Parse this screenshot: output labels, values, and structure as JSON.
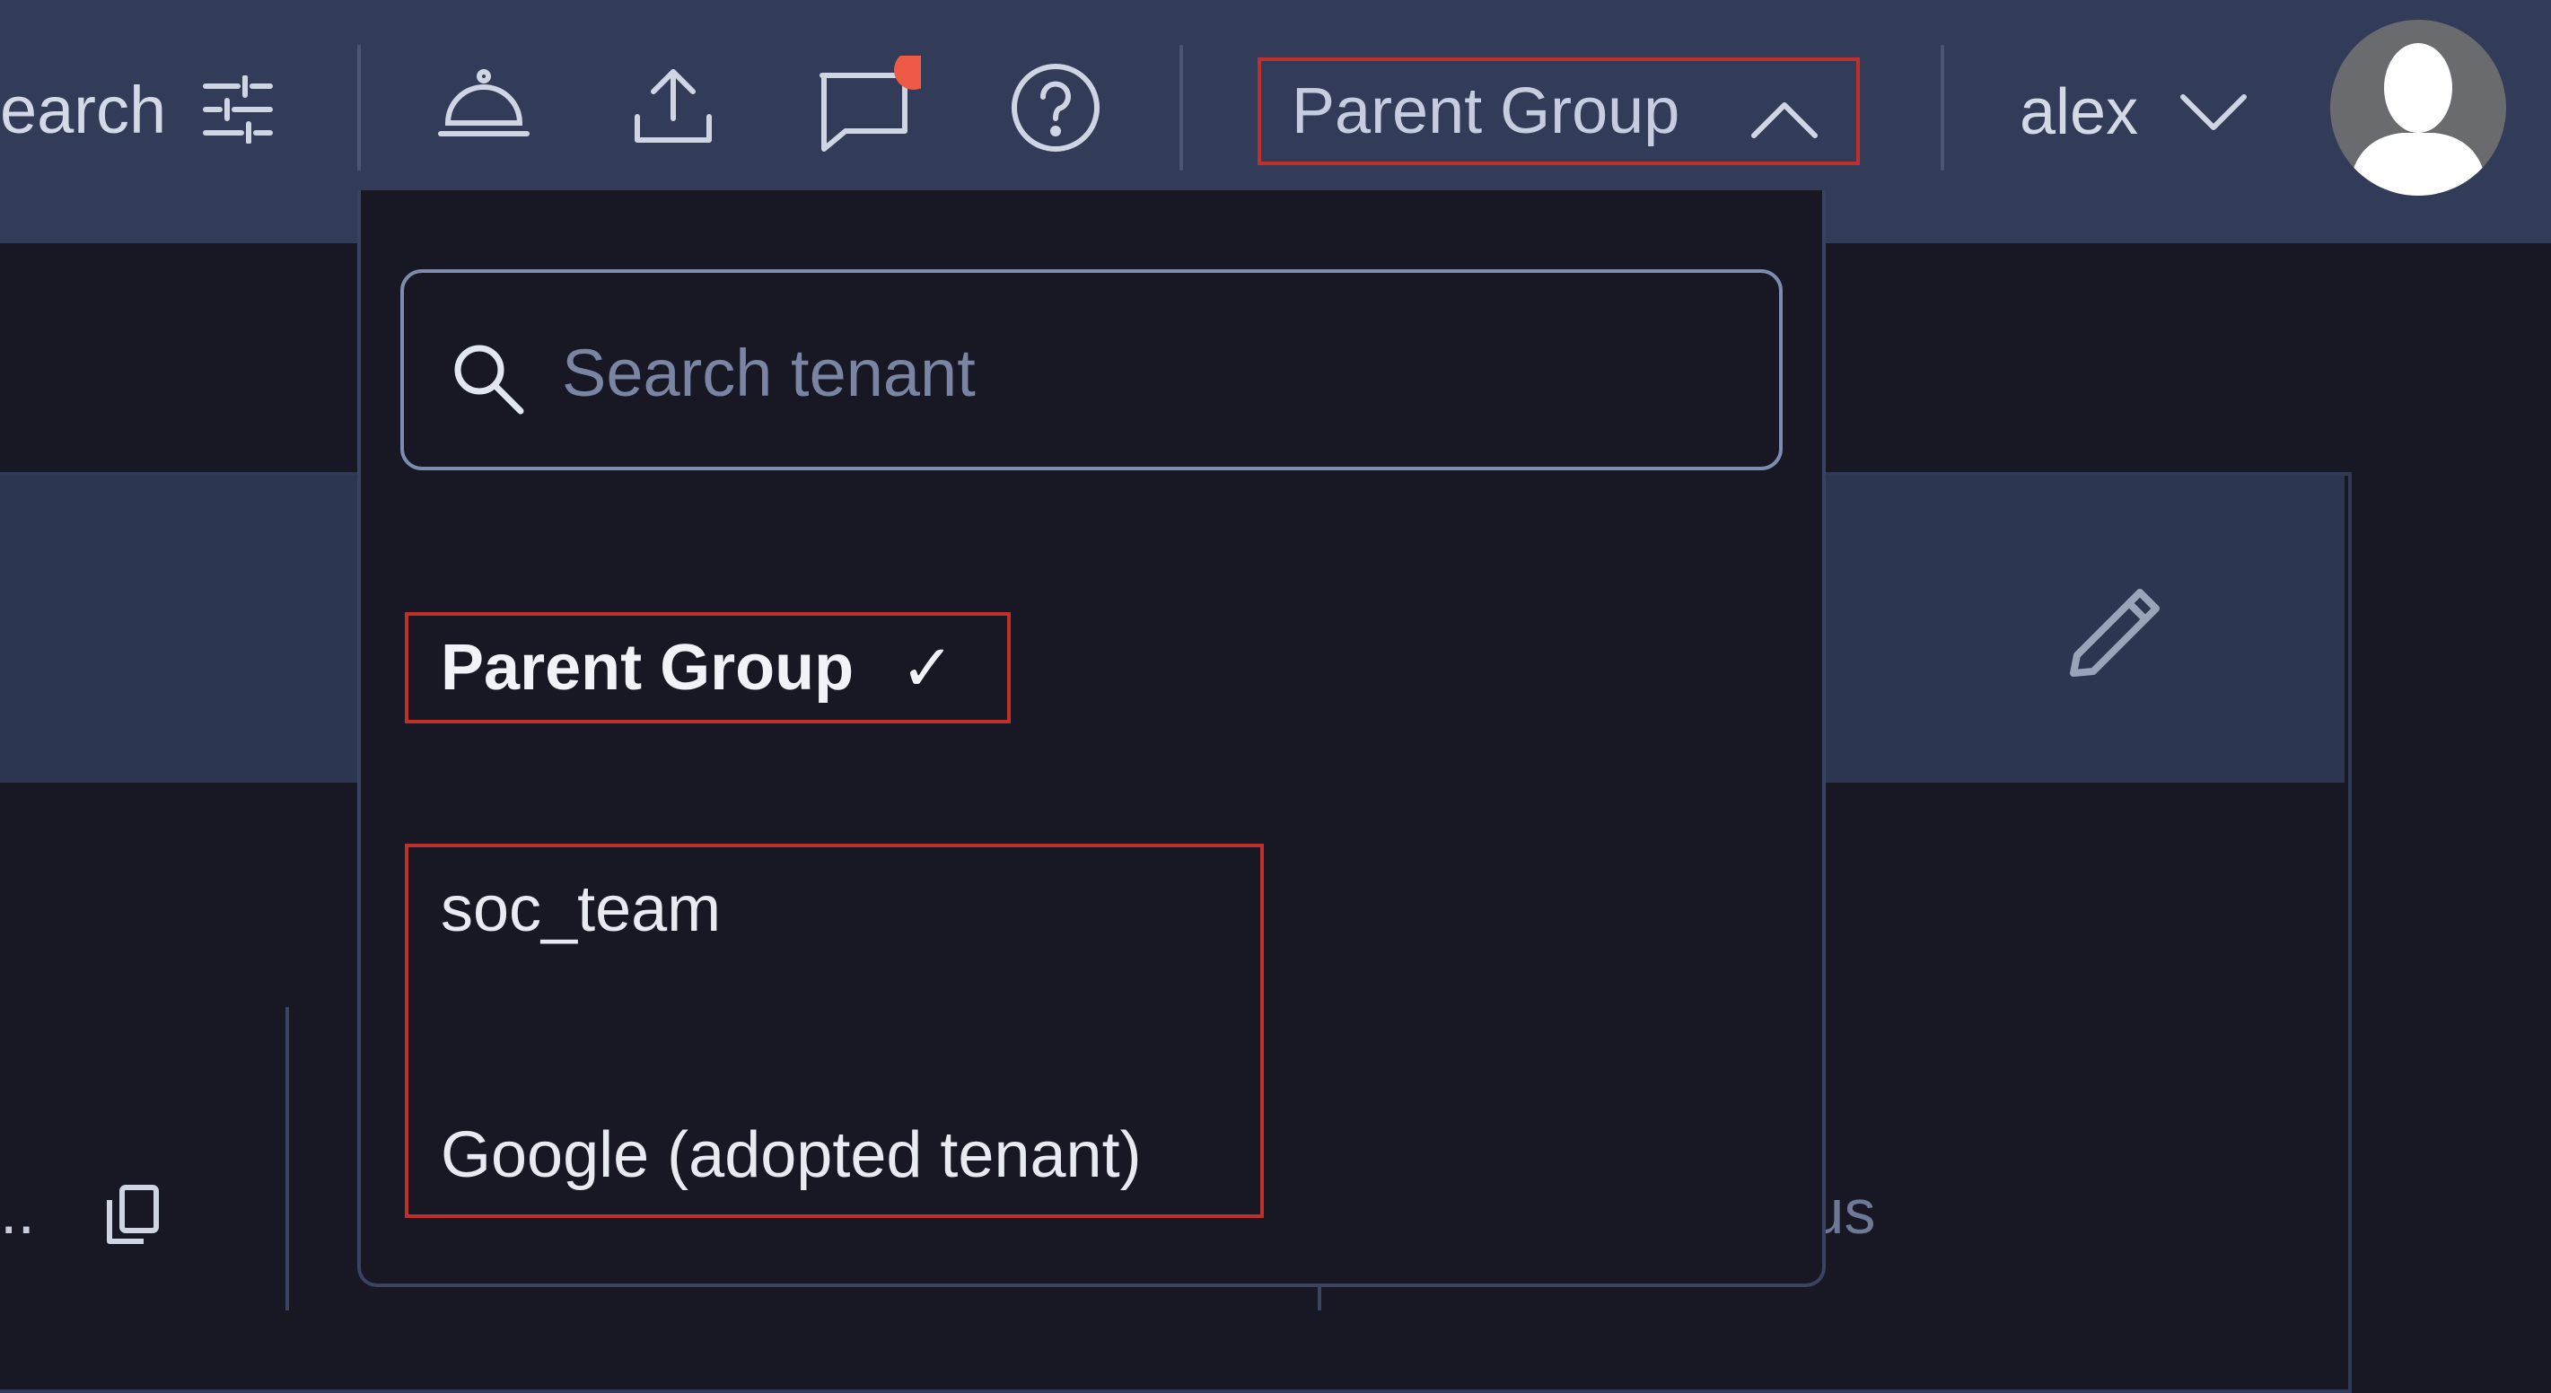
{
  "header": {
    "search_partial": "earch",
    "tenant_selector": {
      "label": "Parent Group"
    },
    "user": {
      "name": "alex"
    }
  },
  "dropdown": {
    "search_placeholder": "Search tenant",
    "selected_option": {
      "label": "Parent Group",
      "check": "✓"
    },
    "options": [
      {
        "label": "soc_team"
      },
      {
        "label": "Google (adopted tenant)"
      }
    ]
  },
  "background": {
    "truncated_text": "..",
    "partial_text": "lus"
  },
  "colors": {
    "topbar": "#323c58",
    "page_bg": "#171824",
    "highlight_border": "#c0302b",
    "notification_dot": "#ee5a45"
  },
  "icons": [
    "filter-sliders-icon",
    "service-bell-icon",
    "upload-icon",
    "chat-icon",
    "help-icon",
    "chevron-up-icon",
    "chevron-down-icon",
    "avatar-icon",
    "search-icon",
    "edit-pencil-icon",
    "copy-icon"
  ]
}
